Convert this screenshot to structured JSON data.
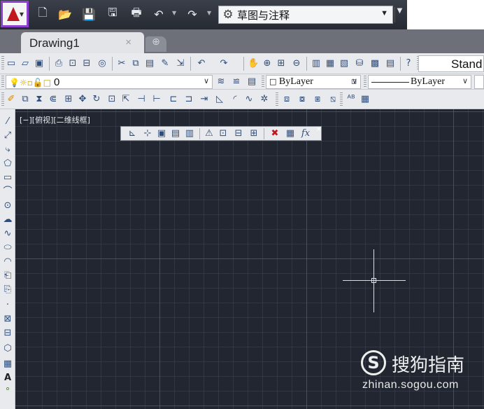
{
  "quick_access": {
    "workspace": "草图与注释",
    "icons": [
      "new-icon",
      "open-icon",
      "save-icon",
      "save-as-icon",
      "plot-icon",
      "undo-icon",
      "redo-icon",
      "workspace-gear-icon"
    ]
  },
  "tabs": [
    {
      "label": "Drawing1",
      "close": "×"
    }
  ],
  "toolbar": {
    "text_style": "Stand",
    "layer": "0",
    "color": "ByLayer",
    "linetype": "ByLayer"
  },
  "viewport": {
    "label": "[−][俯视][二维线框]"
  },
  "float_toolbar": {
    "fx": "fx",
    "close": "×"
  },
  "watermark": {
    "logo": "S",
    "brand": "搜狗指南",
    "url": "zhinan.sogou.com"
  },
  "colors": {
    "canvas": "#212630",
    "app_button_highlight": "#8e3fcf",
    "app_logo": "#c0181d"
  }
}
